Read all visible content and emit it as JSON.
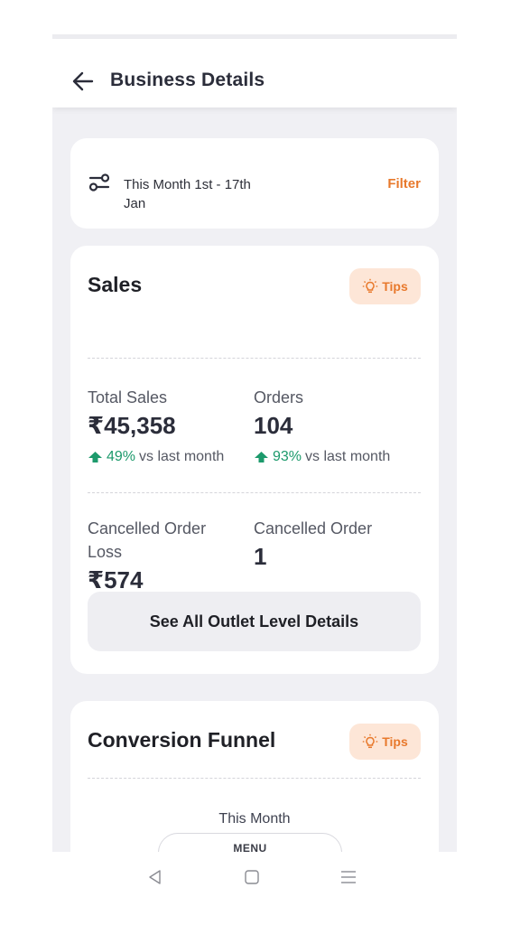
{
  "header": {
    "title": "Business Details"
  },
  "filter": {
    "range_text": "This Month 1st - 17th Jan",
    "link_label": "Filter"
  },
  "sales": {
    "title": "Sales",
    "tips_label": "Tips",
    "total_sales": {
      "label": "Total Sales",
      "value": "₹45,358",
      "change_pct": "49%",
      "change_suffix": "vs last month"
    },
    "orders": {
      "label": "Orders",
      "value": "104",
      "change_pct": "93%",
      "change_suffix": "vs last month"
    },
    "cancelled_loss": {
      "label": "Cancelled Order Loss",
      "value": "₹574"
    },
    "cancelled_order": {
      "label": "Cancelled Order",
      "value": "1"
    },
    "outlet_button": "See All Outlet Level Details"
  },
  "funnel": {
    "title": "Conversion Funnel",
    "tips_label": "Tips",
    "period": "This Month"
  },
  "menu_label": "MENU",
  "colors": {
    "accent": "#e8792c",
    "tips_bg": "#fde6d7",
    "positive": "#1d9a6c",
    "page_bg": "#f0f0f4"
  },
  "icons": [
    "back-arrow-icon",
    "sliders-icon",
    "bulb-icon",
    "arrow-up-icon",
    "nav-back-icon",
    "nav-home-icon",
    "nav-menu-icon"
  ]
}
